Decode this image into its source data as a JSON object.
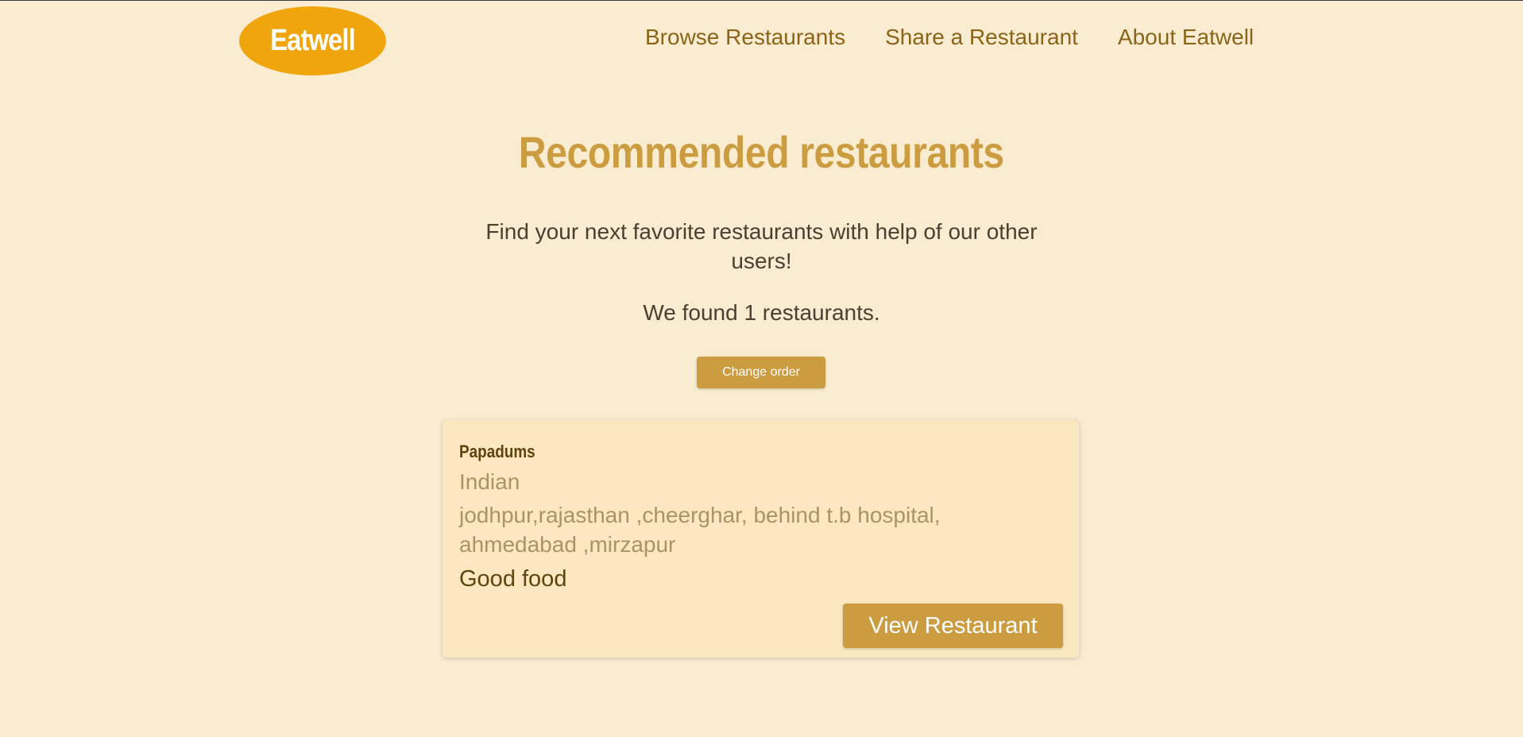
{
  "header": {
    "logo_text": "Eatwell",
    "nav": [
      {
        "label": "Browse Restaurants"
      },
      {
        "label": "Share a Restaurant"
      },
      {
        "label": "About Eatwell"
      }
    ]
  },
  "main": {
    "title": "Recommended restaurants",
    "subtitle": "Find your next favorite restaurants with help of our other users!",
    "found_text": "We found 1 restaurants.",
    "change_order_label": "Change order",
    "restaurants": [
      {
        "name": "Papadums",
        "cuisine": "Indian",
        "address": "jodhpur,rajasthan ,cheerghar, behind t.b hospital, ahmedabad ,mirzapur",
        "review": "Good food",
        "view_label": "View Restaurant"
      }
    ]
  },
  "colors": {
    "background": "#faecd0",
    "logo": "#f0a50c",
    "accent": "#cc9c40",
    "nav_text": "#8a6418",
    "card_background": "#fbe8c0"
  }
}
